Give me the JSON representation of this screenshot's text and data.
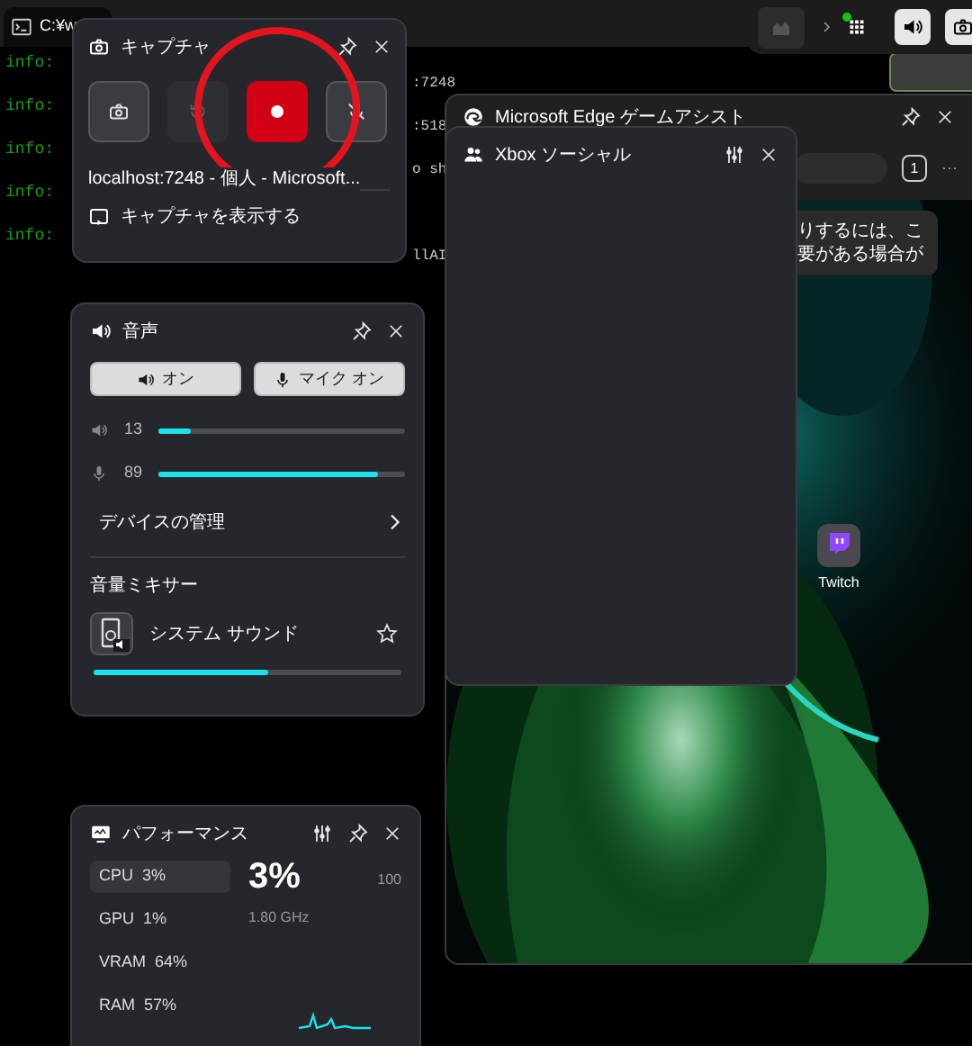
{
  "terminal": {
    "tab_title": "C:¥w",
    "lines": [
      {
        "tag": "info:",
        "tail": ":7248"
      },
      {
        "tag": "info:",
        "tail": ":518"
      },
      {
        "tag": "info:",
        "tail": "o sh"
      },
      {
        "tag": "info:"
      },
      {
        "tag": "info:",
        "tail": "llAI"
      }
    ]
  },
  "capture": {
    "title": "キャプチャ",
    "buttons": [
      {
        "kind": "screenshot",
        "disabled": false
      },
      {
        "kind": "record_last",
        "disabled": true
      },
      {
        "kind": "record",
        "disabled": false
      },
      {
        "kind": "mic",
        "disabled": false
      }
    ],
    "target": "localhost:7248 - 個人 - Microsoft...",
    "show_captures": "キャプチャを表示する"
  },
  "edge_assist": {
    "title": "Microsoft Edge ゲームアシスト",
    "tab_count": "1",
    "more": "···",
    "notice_lines": [
      "りするには、こ",
      "要がある場合が"
    ],
    "desktop_icons": [
      {
        "label": "Twitch"
      }
    ]
  },
  "xbox_social": {
    "title": "Xbox ソーシャル"
  },
  "audio": {
    "title": "音声",
    "toggles": [
      {
        "kind": "speaker",
        "label": "オン"
      },
      {
        "kind": "mic",
        "label": "マイク オン"
      }
    ],
    "sliders": [
      {
        "kind": "speaker",
        "reading": "13",
        "level": 0.13
      },
      {
        "kind": "mic",
        "reading": "89",
        "level": 0.89
      }
    ],
    "device_link": "デバイスの管理",
    "mixer_title": "音量ミキサー",
    "apps": [
      {
        "name": "システム サウンド",
        "favorite": false,
        "level": 0.57
      }
    ]
  },
  "performance": {
    "title": "パフォーマンス",
    "metrics": [
      {
        "label": "CPU",
        "value": "3%",
        "selected": true
      },
      {
        "label": "GPU",
        "value": "1%",
        "selected": false
      },
      {
        "label": "VRAM",
        "value": "64%",
        "selected": false
      },
      {
        "label": "RAM",
        "value": "57%",
        "selected": false
      }
    ],
    "big_value": "3%",
    "frequency": "1.80 GHz",
    "max": "100"
  }
}
